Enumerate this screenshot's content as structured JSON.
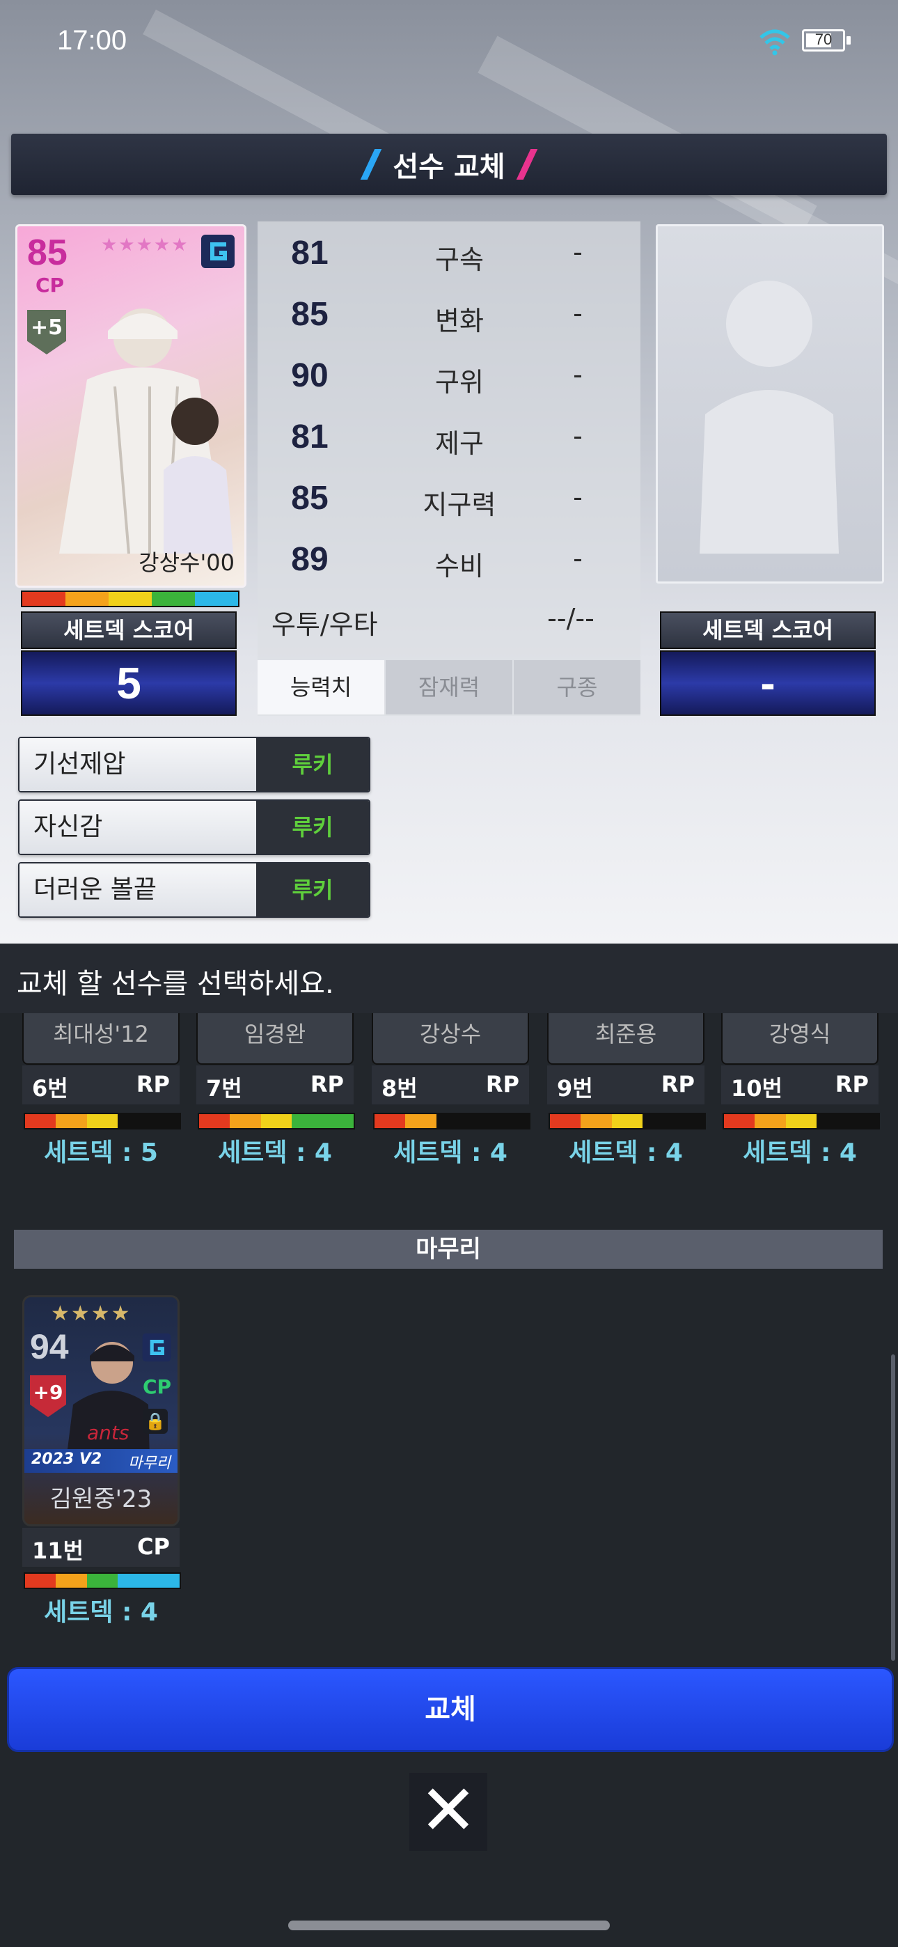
{
  "status_bar": {
    "time": "17:00",
    "battery": "70"
  },
  "dialog": {
    "title": "선수 교체",
    "accent_left": "#2aa6f5",
    "accent_right": "#e8338e"
  },
  "current_player": {
    "rating": "85",
    "position": "CP",
    "plus": "+5",
    "name": "강상수'00",
    "score_label": "세트덱 스코어",
    "score": "5"
  },
  "stats": [
    {
      "value": "81",
      "label": "구속",
      "compare": "-"
    },
    {
      "value": "85",
      "label": "변화",
      "compare": "-"
    },
    {
      "value": "90",
      "label": "구위",
      "compare": "-"
    },
    {
      "value": "81",
      "label": "제구",
      "compare": "-"
    },
    {
      "value": "85",
      "label": "지구력",
      "compare": "-"
    },
    {
      "value": "89",
      "label": "수비",
      "compare": "-"
    }
  ],
  "hand": {
    "label": "우투/우타",
    "compare": "--/--"
  },
  "tabs": [
    "능력치",
    "잠재력",
    "구종"
  ],
  "target_player": {
    "score_label": "세트덱 스코어",
    "score": "-"
  },
  "skills": [
    {
      "name": "기선제압",
      "level": "루키"
    },
    {
      "name": "자신감",
      "level": "루키"
    },
    {
      "name": "더러운 볼끝",
      "level": "루키"
    }
  ],
  "instruction": "교체 할 선수를 선택하세요.",
  "bullpen": [
    {
      "name": "최대성'12",
      "number": "6번",
      "pos": "RP",
      "setdeck": "세트덱 : 5"
    },
    {
      "name": "임경완",
      "number": "7번",
      "pos": "RP",
      "setdeck": "세트덱 : 4"
    },
    {
      "name": "강상수",
      "number": "8번",
      "pos": "RP",
      "setdeck": "세트덱 : 4"
    },
    {
      "name": "최준용",
      "number": "9번",
      "pos": "RP",
      "setdeck": "세트덱 : 4"
    },
    {
      "name": "강영식",
      "number": "10번",
      "pos": "RP",
      "setdeck": "세트덱 : 4"
    }
  ],
  "closer_section": {
    "title": "마무리"
  },
  "closer": {
    "rating": "94",
    "plus": "+9",
    "pos_badge": "CP",
    "edition": "2023 V2",
    "role": "마무리",
    "name": "김원중'23",
    "number": "11번",
    "pos": "CP",
    "setdeck": "세트덱 : 4"
  },
  "buttons": {
    "replace": "교체",
    "close": "✕"
  }
}
